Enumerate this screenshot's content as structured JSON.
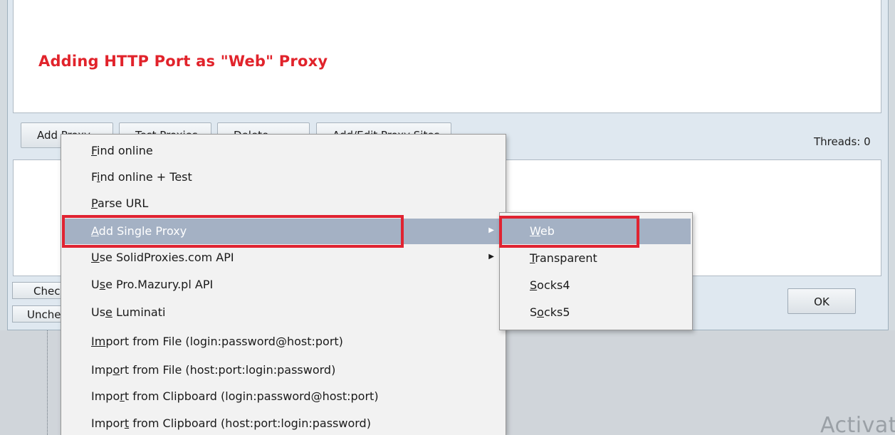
{
  "banner": {
    "title": "Adding HTTP Port as \"Web\" Proxy"
  },
  "toolbar": {
    "add_proxy_label": "Add Proxy",
    "test_proxies_label": "Test Proxies",
    "delete_label": "Delete",
    "add_edit_sites_label": "Add/Edit Proxy Sites",
    "threads_label": "Threads: 0"
  },
  "bottom_buttons": {
    "check_label": "Check",
    "uncheck_label": "Uncheck",
    "ok_label": "OK"
  },
  "menu": {
    "items": [
      {
        "pre": "",
        "key": "F",
        "post": "ind online"
      },
      {
        "pre": "F",
        "key": "i",
        "post": "nd online + Test"
      },
      {
        "pre": "",
        "key": "P",
        "post": "arse URL"
      },
      {
        "pre": "",
        "key": "A",
        "post": "dd Single Proxy",
        "submenu": true,
        "highlighted": true
      },
      {
        "pre": "",
        "key": "U",
        "post": "se SolidProxies.com API",
        "submenu": true
      },
      {
        "pre": "U",
        "key": "s",
        "post": "e Pro.Mazury.pl API"
      },
      {
        "pre": "Us",
        "key": "e",
        "post": " Luminati"
      },
      {
        "pre": "",
        "key": "Im",
        "post": "port from File (login:password@host:port)"
      },
      {
        "pre": "Imp",
        "key": "o",
        "post": "rt from File (host:port:login:password)"
      },
      {
        "pre": "Impo",
        "key": "r",
        "post": "t from Clipboard (login:password@host:port)"
      },
      {
        "pre": "Impor",
        "key": "t",
        "post": " from Clipboard (host:port:login:password)"
      }
    ]
  },
  "submenu": {
    "items": [
      {
        "pre": "",
        "key": "W",
        "post": "eb",
        "highlighted": true
      },
      {
        "pre": "",
        "key": "T",
        "post": "ransparent"
      },
      {
        "pre": "",
        "key": "S",
        "post": "ocks4"
      },
      {
        "pre": "S",
        "key": "o",
        "post": "cks5"
      }
    ]
  },
  "watermark": "Activat",
  "colors": {
    "highlight": "#a4b1c4",
    "annotation_red": "#e02331",
    "banner_text": "#e1232b"
  }
}
